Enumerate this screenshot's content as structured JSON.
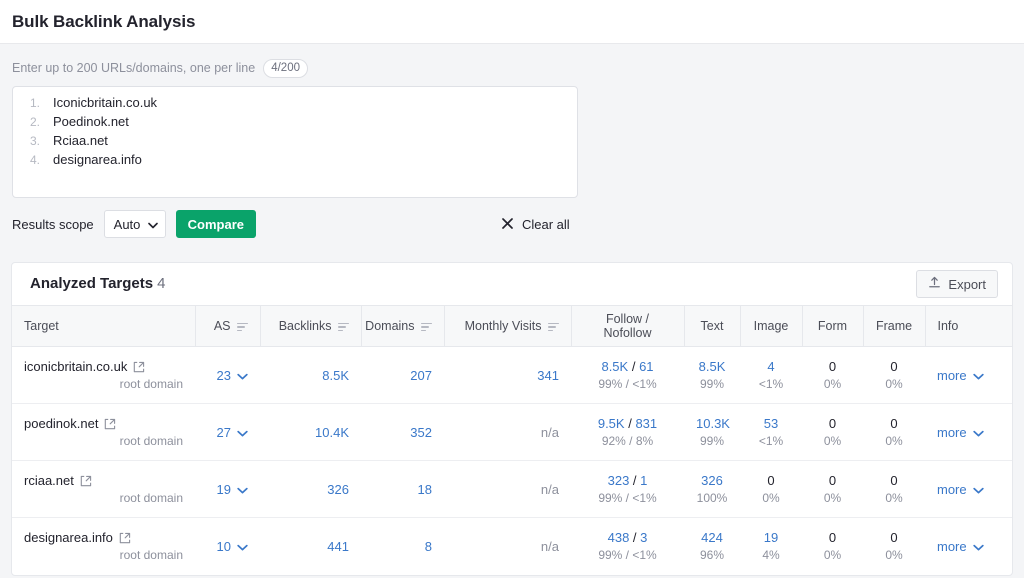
{
  "header": {
    "title": "Bulk Backlink Analysis"
  },
  "input": {
    "hint": "Enter up to 200 URLs/domains, one per line",
    "counter": "4/200",
    "lines": [
      {
        "num": "1.",
        "value": "Iconicbritain.co.uk"
      },
      {
        "num": "2.",
        "value": "Poedinok.net"
      },
      {
        "num": "3.",
        "value": "Rciaa.net"
      },
      {
        "num": "4.",
        "value": "designarea.info"
      }
    ]
  },
  "controls": {
    "scope_label": "Results scope",
    "scope_value": "Auto",
    "compare_label": "Compare",
    "clear_all_label": "Clear all"
  },
  "results": {
    "title": "Analyzed Targets",
    "count": "4",
    "export_label": "Export",
    "columns": [
      "Target",
      "AS",
      "Backlinks",
      "Domains",
      "Monthly Visits",
      "Follow / Nofollow",
      "Text",
      "Image",
      "Form",
      "Frame",
      "Info"
    ],
    "rows": [
      {
        "target": "iconicbritain.co.uk",
        "target_sub": "root domain",
        "as": "23",
        "backlinks": "8.5K",
        "domains": "207",
        "visits": "341",
        "visits_link": true,
        "follow": "8.5K",
        "nofollow": "61",
        "follow_pct": "99% / <1%",
        "text": "8.5K",
        "text_pct": "99%",
        "text_link": true,
        "image": "4",
        "image_pct": "<1%",
        "image_link": true,
        "form": "0",
        "form_pct": "0%",
        "form_link": false,
        "frame": "0",
        "frame_pct": "0%",
        "frame_link": false,
        "info": "more"
      },
      {
        "target": "poedinok.net",
        "target_sub": "root domain",
        "as": "27",
        "backlinks": "10.4K",
        "domains": "352",
        "visits": "n/a",
        "visits_link": false,
        "follow": "9.5K",
        "nofollow": "831",
        "follow_pct": "92% / 8%",
        "text": "10.3K",
        "text_pct": "99%",
        "text_link": true,
        "image": "53",
        "image_pct": "<1%",
        "image_link": true,
        "form": "0",
        "form_pct": "0%",
        "form_link": false,
        "frame": "0",
        "frame_pct": "0%",
        "frame_link": false,
        "info": "more"
      },
      {
        "target": "rciaa.net",
        "target_sub": "root domain",
        "as": "19",
        "backlinks": "326",
        "domains": "18",
        "visits": "n/a",
        "visits_link": false,
        "follow": "323",
        "nofollow": "1",
        "follow_pct": "99% / <1%",
        "text": "326",
        "text_pct": "100%",
        "text_link": true,
        "image": "0",
        "image_pct": "0%",
        "image_link": false,
        "form": "0",
        "form_pct": "0%",
        "form_link": false,
        "frame": "0",
        "frame_pct": "0%",
        "frame_link": false,
        "info": "more"
      },
      {
        "target": "designarea.info",
        "target_sub": "root domain",
        "as": "10",
        "backlinks": "441",
        "domains": "8",
        "visits": "n/a",
        "visits_link": false,
        "follow": "438",
        "nofollow": "3",
        "follow_pct": "99% / <1%",
        "text": "424",
        "text_pct": "96%",
        "text_link": true,
        "image": "19",
        "image_pct": "4%",
        "image_link": true,
        "form": "0",
        "form_pct": "0%",
        "form_link": false,
        "frame": "0",
        "frame_pct": "0%",
        "frame_link": false,
        "info": "more"
      }
    ]
  },
  "colors": {
    "accent_green": "#0aa36a",
    "link_blue": "#3a78c9",
    "text_dark": "#23232d",
    "text_muted": "#8d909c"
  }
}
